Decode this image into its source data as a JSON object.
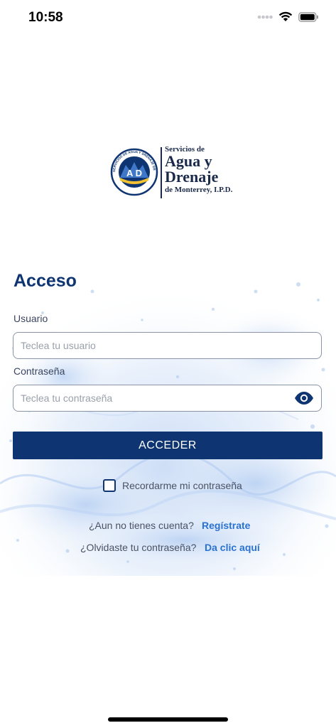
{
  "status_bar": {
    "time": "10:58"
  },
  "logo": {
    "line1": "Servicios de",
    "line2": "Agua y",
    "line3": "Drenaje",
    "line4": "de Monterrey, I.P.D.",
    "seal_ring_text": "SERVICIOS DE AGUA Y DRENAJE DE MONTERREY, I.P.D.",
    "seal_monogram": "A D"
  },
  "login": {
    "title": "Acceso",
    "user_label": "Usuario",
    "user_placeholder": "Teclea tu usuario",
    "user_value": "",
    "password_label": "Contraseña",
    "password_placeholder": "Teclea tu contraseña",
    "password_value": "",
    "submit_label": "ACCEDER",
    "remember_label": "Recordarme mi contraseña",
    "remember_checked": false,
    "no_account_text": "¿Aun no tienes cuenta?",
    "register_link": "Regístrate",
    "forgot_text": "¿Olvidaste tu contraseña?",
    "forgot_link": "Da clic aquí"
  },
  "colors": {
    "primary": "#0e3571",
    "link": "#2a72d1",
    "input_border": "#8b94a7"
  },
  "icons": {
    "signal": "cellular-signal-icon",
    "wifi": "wifi-icon",
    "battery": "battery-icon",
    "eye": "eye-icon"
  }
}
